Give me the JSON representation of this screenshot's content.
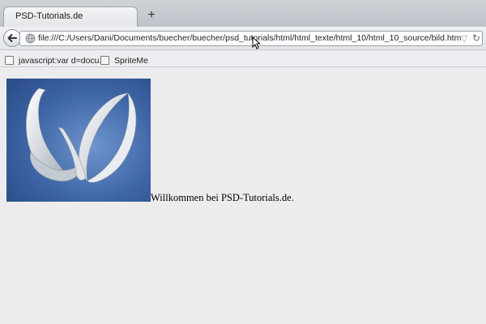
{
  "browser": {
    "tab_title": "PSD-Tutorials.de",
    "new_tab_icon": "plus-icon",
    "url": "file:///C:/Users/Dani/Documents/buecher/buecher/psd_tutorials/html/html_texte/html_10/html_10_source/bild.htm"
  },
  "bookmarks": [
    {
      "label": "javascript:var d=docu...",
      "icon": "bookmark-page-icon"
    },
    {
      "label": "SpriteMe",
      "icon": "bookmark-page-icon"
    }
  ],
  "page": {
    "welcome_text": "Willkommen bei PSD-Tutorials.de.",
    "image_icon": "butterfly-logo-image"
  },
  "colors": {
    "logo_background": "#3d64a4",
    "page_background": "#ececec"
  }
}
